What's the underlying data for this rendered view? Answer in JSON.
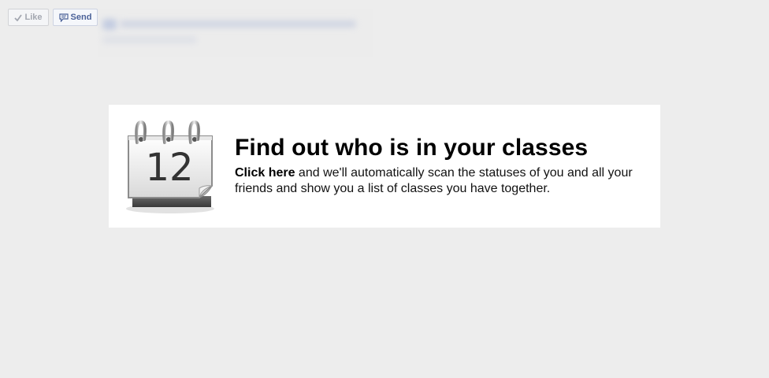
{
  "toolbar": {
    "like_label": "Like",
    "send_label": "Send"
  },
  "promo": {
    "title": "Find out who is in your classes",
    "link_text": "Click here",
    "body_text": " and we'll automatically scan the statuses of you and all your friends and show you a list of classes you have together.",
    "calendar_day": "12"
  },
  "icons": {
    "like": "checkmark-icon",
    "send": "speech-bubble-icon",
    "promo": "calendar-icon"
  },
  "colors": {
    "page_background": "#ededed",
    "card_background": "#ffffff",
    "send_text": "#4a6198",
    "like_text": "#a3a7b0"
  }
}
